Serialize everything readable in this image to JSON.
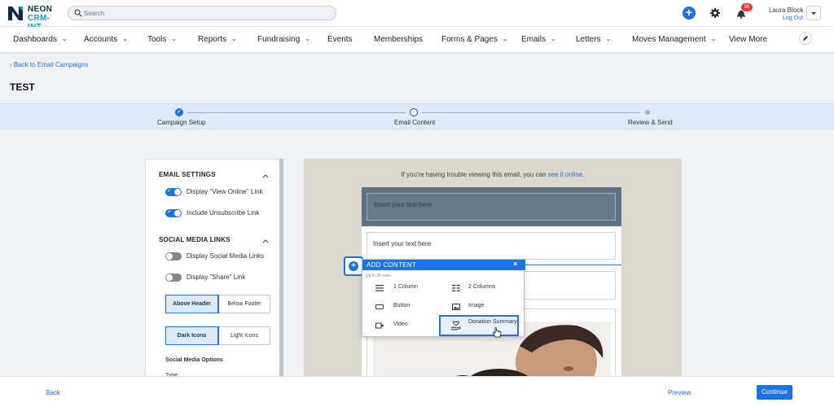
{
  "app": {
    "logo_line1": "NEON",
    "logo_line2": "CRM-INT",
    "brand_color": "#1a73e8"
  },
  "topbar": {
    "search_placeholder": "Search",
    "add_icon": "plus-icon",
    "settings_icon": "gear-icon",
    "notifications_icon": "bell-icon",
    "notification_count": "98",
    "user_name": "Laura Block",
    "logout_label": "Log Out"
  },
  "nav": {
    "items": [
      {
        "label": "Dashboards",
        "dropdown": true
      },
      {
        "label": "Accounts",
        "dropdown": true
      },
      {
        "label": "Tools",
        "dropdown": true
      },
      {
        "label": "Reports",
        "dropdown": true
      },
      {
        "label": "Fundraising",
        "dropdown": true
      },
      {
        "label": "Events",
        "dropdown": false
      },
      {
        "label": "Memberships",
        "dropdown": false
      },
      {
        "label": "Forms & Pages",
        "dropdown": true
      },
      {
        "label": "Emails",
        "dropdown": true
      },
      {
        "label": "Letters",
        "dropdown": true
      },
      {
        "label": "Moves Management",
        "dropdown": true
      },
      {
        "label": "View More",
        "dropdown": false
      }
    ]
  },
  "page": {
    "back_link": "Back to Email Campaigns",
    "title": "TEST"
  },
  "stepper": {
    "steps": [
      {
        "label": "Campaign Setup",
        "state": "done"
      },
      {
        "label": "Email Content",
        "state": "current"
      },
      {
        "label": "Review & Send",
        "state": "upcoming"
      }
    ]
  },
  "settings_panel": {
    "email_settings_title": "EMAIL SETTINGS",
    "view_online_label": "Display \"View Online\" Link",
    "view_online_on": true,
    "unsubscribe_label": "Include Unsubscribe Link",
    "unsubscribe_on": true,
    "social_title": "SOCIAL MEDIA LINKS",
    "social_links_label": "Display Social Media Links",
    "social_links_on": false,
    "share_label": "Display \"Share\" Link",
    "share_on": false,
    "position_options": [
      "Above Header",
      "Below Footer"
    ],
    "position_selected": "Above Header",
    "icon_options": [
      "Dark Icons",
      "Light Icons"
    ],
    "icon_selected": "Dark Icons",
    "social_options_title": "Social Media Options",
    "type_label": "Type"
  },
  "email_preview": {
    "trouble_text": "If you're having trouble viewing this email, you can",
    "trouble_link": "see it online.",
    "header_placeholder": "Insert your text here",
    "text_placeholder": "Insert your text here"
  },
  "add_content": {
    "title": "ADD CONTENT",
    "subtitle": "Up to 25 rows",
    "options": [
      {
        "label": "1 Column",
        "icon": "one-column-icon"
      },
      {
        "label": "2 Columns",
        "icon": "two-columns-icon"
      },
      {
        "label": "Button",
        "icon": "button-icon"
      },
      {
        "label": "Image",
        "icon": "image-icon"
      },
      {
        "label": "Video",
        "icon": "video-icon"
      },
      {
        "label": "Donation Summary",
        "icon": "donation-icon"
      }
    ]
  },
  "footer": {
    "back_label": "Back",
    "preview_label": "Preview",
    "continue_label": "Continue"
  }
}
